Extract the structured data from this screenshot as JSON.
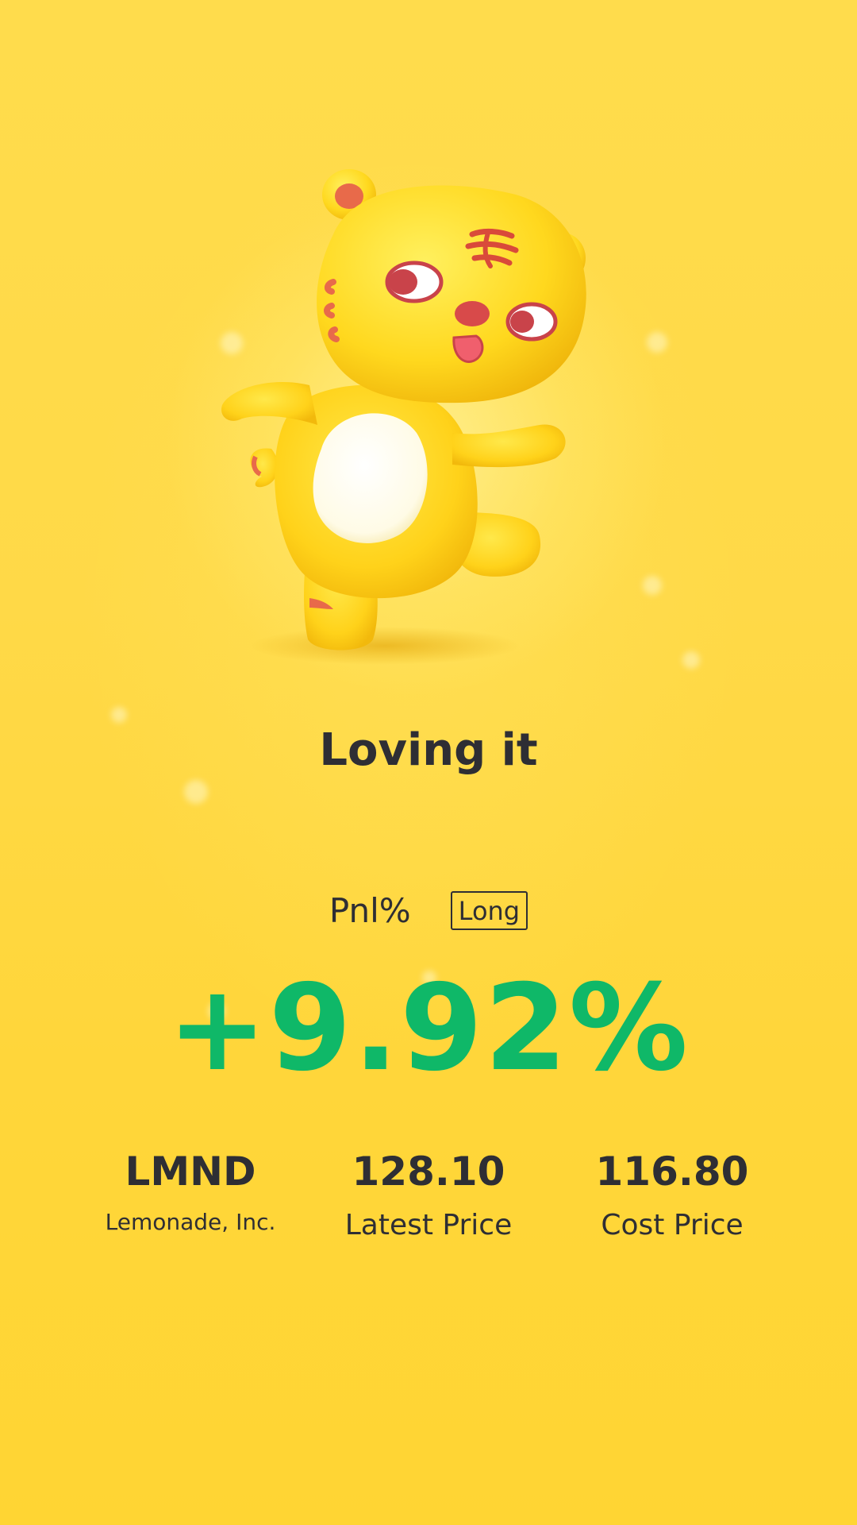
{
  "mood": {
    "title": "Loving it"
  },
  "pnl": {
    "label": "Pnl%",
    "position_tag": "Long",
    "value": "+9.92%",
    "value_color": "#0fb868"
  },
  "stock": {
    "symbol": "LMND",
    "company": "Lemonade, Inc."
  },
  "prices": {
    "latest_value": "128.10",
    "latest_label": "Latest Price",
    "cost_value": "116.80",
    "cost_label": "Cost Price"
  },
  "colors": {
    "background": "#ffd63a",
    "text": "#2e2e34",
    "gain": "#0fb868"
  },
  "icons": {
    "mascot": "tiger-mascot-icon"
  }
}
